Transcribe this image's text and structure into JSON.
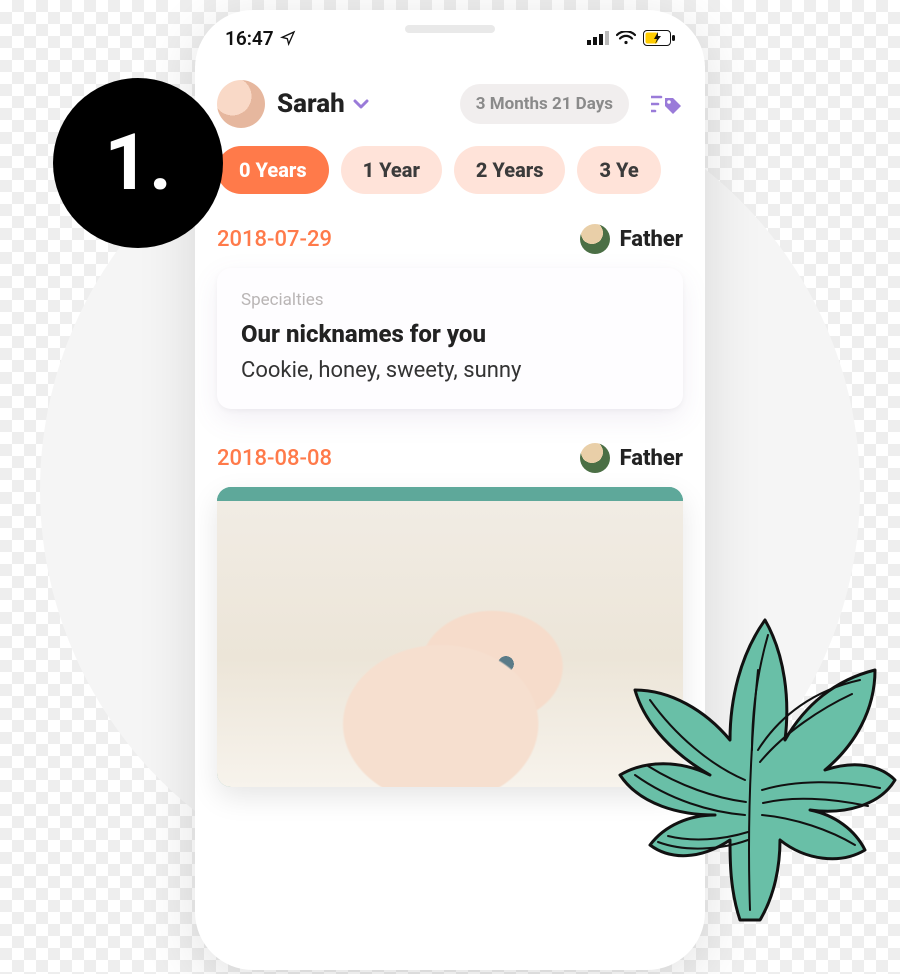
{
  "step_number": "1.",
  "statusbar": {
    "time": "16:47"
  },
  "profile": {
    "name": "Sarah",
    "age_pill": "3 Months 21 Days"
  },
  "year_tabs": [
    "0 Years",
    "1 Year",
    "2 Years",
    "3 Ye"
  ],
  "active_year_index": 0,
  "entries": [
    {
      "date": "2018-07-29",
      "author": "Father",
      "card": {
        "label": "Specialties",
        "title": "Our nicknames for you",
        "body": "Cookie, honey, sweety, sunny"
      }
    },
    {
      "date": "2018-08-08",
      "author": "Father"
    }
  ],
  "colors": {
    "accent": "#ff7a4a",
    "tag": "#9a7bd9",
    "pill_bg": "#ffe3d9",
    "leaf": "#69BFA7"
  }
}
